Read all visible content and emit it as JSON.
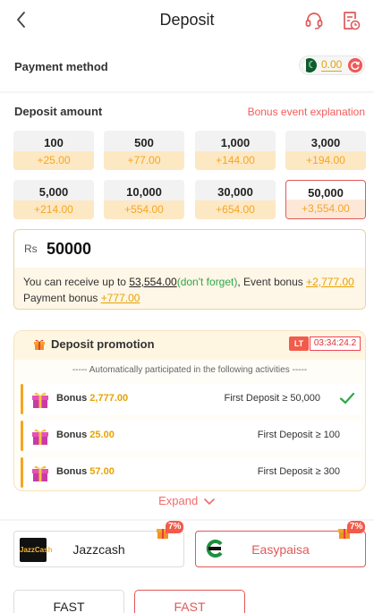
{
  "header": {
    "title": "Deposit"
  },
  "payment_method": {
    "label": "Payment method",
    "balance": "0.00"
  },
  "deposit_amount": {
    "label": "Deposit amount",
    "bonus_link": "Bonus event explanation",
    "options": [
      {
        "amount": "100",
        "bonus": "+25.00"
      },
      {
        "amount": "500",
        "bonus": "+77.00"
      },
      {
        "amount": "1,000",
        "bonus": "+144.00"
      },
      {
        "amount": "3,000",
        "bonus": "+194.00"
      },
      {
        "amount": "5,000",
        "bonus": "+214.00"
      },
      {
        "amount": "10,000",
        "bonus": "+554.00"
      },
      {
        "amount": "30,000",
        "bonus": "+654.00"
      },
      {
        "amount": "50,000",
        "bonus": "+3,554.00"
      }
    ],
    "selected_index": 7,
    "currency_symbol": "Rs",
    "input_value": "50000",
    "receive_info": {
      "prefix": "You can receive up to ",
      "total": "53,554.00",
      "note": "(don't forget)",
      "event_bonus_label": ", Event bonus ",
      "event_bonus": "+2,777.00",
      "payment_bonus_label": " Payment bonus ",
      "payment_bonus": "+777.00"
    }
  },
  "promotion": {
    "title": "Deposit promotion",
    "lt_badge": "LT",
    "timer": "03:34:24.2",
    "auto_text": "----- Automatically participated in the following activities -----",
    "rows": [
      {
        "bonus_label": "Bonus",
        "bonus_value": "2,777.00",
        "condition": "First Deposit ≥ 50,000",
        "checked": true
      },
      {
        "bonus_label": "Bonus",
        "bonus_value": "25.00",
        "condition": "First Deposit ≥ 100",
        "checked": false
      },
      {
        "bonus_label": "Bonus",
        "bonus_value": "57.00",
        "condition": "First Deposit ≥ 300",
        "checked": false
      }
    ],
    "expand": "Expand"
  },
  "channels": [
    {
      "name": "Jazzcash",
      "logo_text": "JazzCash",
      "tag": "7%",
      "selected": false
    },
    {
      "name": "Easypaisa",
      "tag": "7%",
      "selected": true
    }
  ],
  "speed_options": [
    {
      "label": "FAST",
      "selected": false
    },
    {
      "label": "FAST",
      "selected": true
    }
  ],
  "colors": {
    "accent": "#e15858",
    "gold": "#e8a200",
    "green": "#2ea84a"
  }
}
